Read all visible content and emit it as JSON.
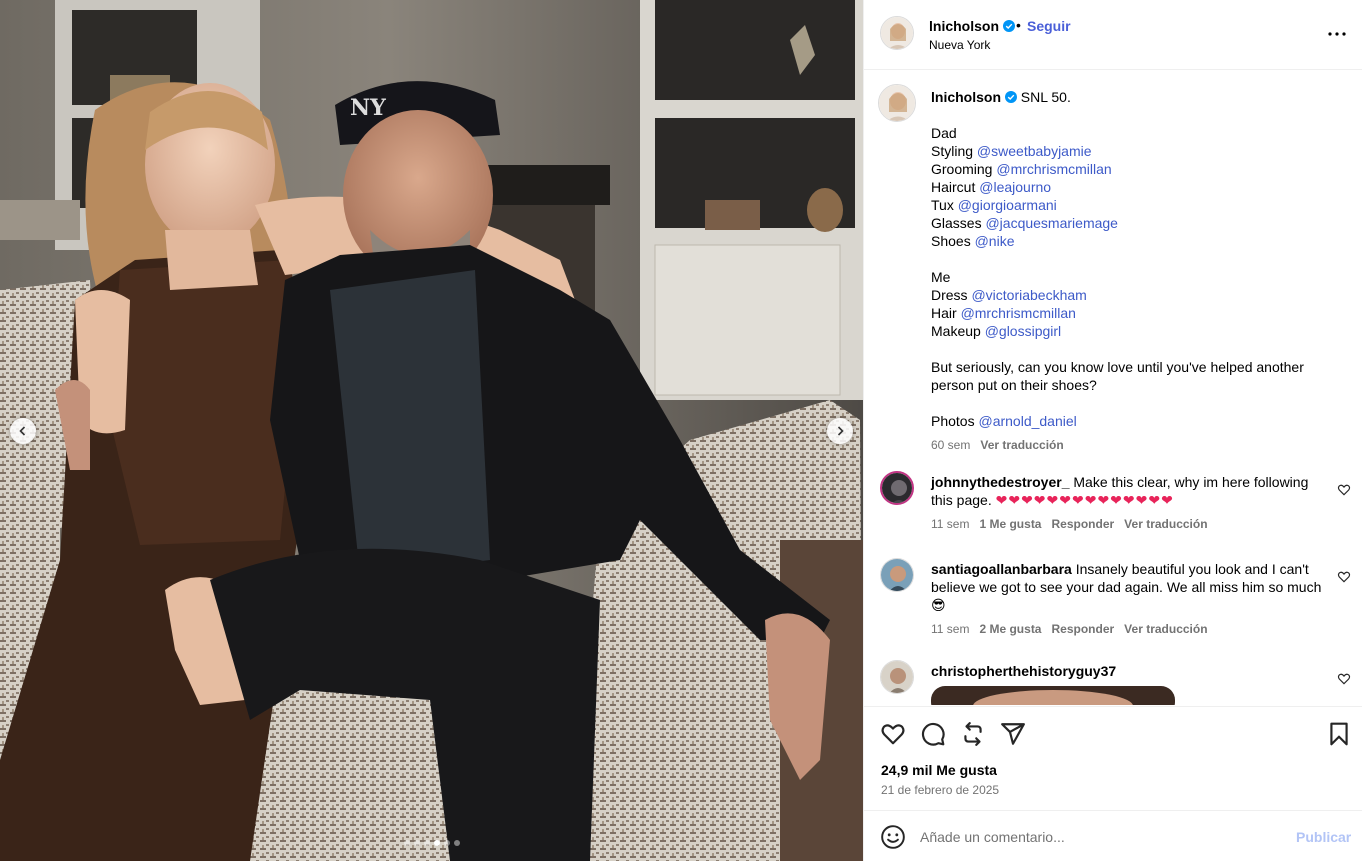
{
  "post": {
    "username": "lnicholson",
    "follow_label": "Seguir",
    "separator": "•",
    "location": "Nueva York",
    "more_icon": "more-horizontal-icon",
    "verified_color": "#0095f6"
  },
  "carousel": {
    "total_slides": 6,
    "active_slide": 4,
    "prev_icon": "chevron-left-icon",
    "next_icon": "chevron-right-icon"
  },
  "caption": {
    "username": "lnicholson",
    "first_line": "SNL 50.",
    "dad_heading": "Dad",
    "credits_dad": [
      {
        "label": "Styling",
        "mention": "@sweetbabyjamie"
      },
      {
        "label": "Grooming",
        "mention": "@mrchrismcmillan"
      },
      {
        "label": "Haircut",
        "mention": "@leajourno"
      },
      {
        "label": "Tux",
        "mention": "@giorgioarmani"
      },
      {
        "label": "Glasses",
        "mention": "@jacquesmariemage"
      },
      {
        "label": "Shoes",
        "mention": "@nike"
      }
    ],
    "me_heading": "Me",
    "credits_me": [
      {
        "label": "Dress",
        "mention": "@victoriabeckham"
      },
      {
        "label": "Hair",
        "mention": "@mrchrismcmillan"
      },
      {
        "label": "Makeup",
        "mention": "@glossipgirl"
      }
    ],
    "question_line1": "But seriously, can you know love until you've helped another",
    "question_line2": "person put on their shoes?",
    "photos_label": "Photos",
    "photos_mention": "@arnold_daniel",
    "time": "60 sem",
    "translate": "Ver traducción"
  },
  "comments": [
    {
      "username": "johnnythedestroyer_",
      "text_line1": "Make this clear, why im here following",
      "text_line2": "this page.",
      "hearts": "❤❤❤❤❤❤❤❤❤❤❤❤❤❤",
      "time": "11 sem",
      "likes": "1 Me gusta",
      "reply": "Responder",
      "translate": "Ver traducción"
    },
    {
      "username": "santiagoallanbarbara",
      "text_line1": "Insanely beautiful you look and I can't",
      "text_line2": "believe we got to see your dad again. We all miss him so much",
      "emoji": "😎",
      "time": "11 sem",
      "likes": "2 Me gusta",
      "reply": "Responder",
      "translate": "Ver traducción"
    },
    {
      "username": "christopherthehistoryguy37"
    }
  ],
  "actions": {
    "icons": [
      "heart-icon",
      "comment-icon",
      "repost-icon",
      "share-icon",
      "bookmark-icon"
    ],
    "likes": "24,9 mil Me gusta",
    "date": "21 de febrero de 2025"
  },
  "add_comment": {
    "placeholder": "Añade un comentario...",
    "publish_label": "Publicar",
    "emoji_icon": "emoji-icon",
    "publish_color": "#b2c4f6"
  }
}
